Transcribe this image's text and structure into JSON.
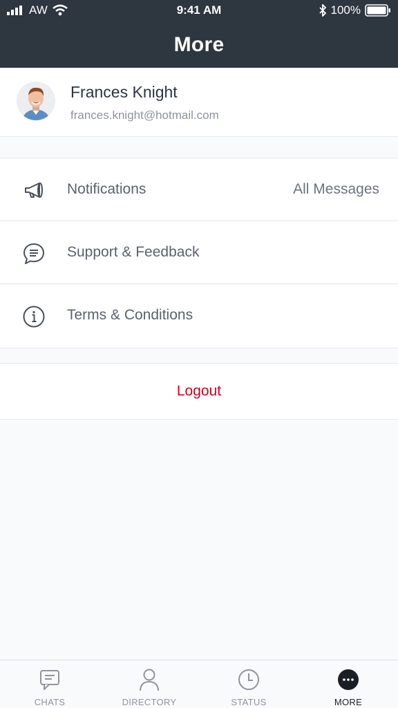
{
  "status_bar": {
    "carrier": "AW",
    "time": "9:41 AM",
    "battery": "100%"
  },
  "nav": {
    "title": "More"
  },
  "profile": {
    "name": "Frances Knight",
    "email": "frances.knight@hotmail.com"
  },
  "menu": {
    "items": [
      {
        "label": "Notifications",
        "value": "All Messages",
        "icon": "megaphone-icon"
      },
      {
        "label": "Support & Feedback",
        "value": "",
        "icon": "chat-bubble-icon"
      },
      {
        "label": "Terms & Conditions",
        "value": "",
        "icon": "info-icon"
      }
    ]
  },
  "logout": {
    "label": "Logout",
    "color": "#d0021b"
  },
  "tabs": [
    {
      "label": "CHATS",
      "icon": "chat-icon",
      "active": false
    },
    {
      "label": "DIRECTORY",
      "icon": "person-icon",
      "active": false
    },
    {
      "label": "STATUS",
      "icon": "clock-icon",
      "active": false
    },
    {
      "label": "MORE",
      "icon": "more-icon",
      "active": true
    }
  ],
  "colors": {
    "header_bg": "#2e3640",
    "page_bg": "#f9fafc",
    "accent_red": "#d0021b"
  }
}
